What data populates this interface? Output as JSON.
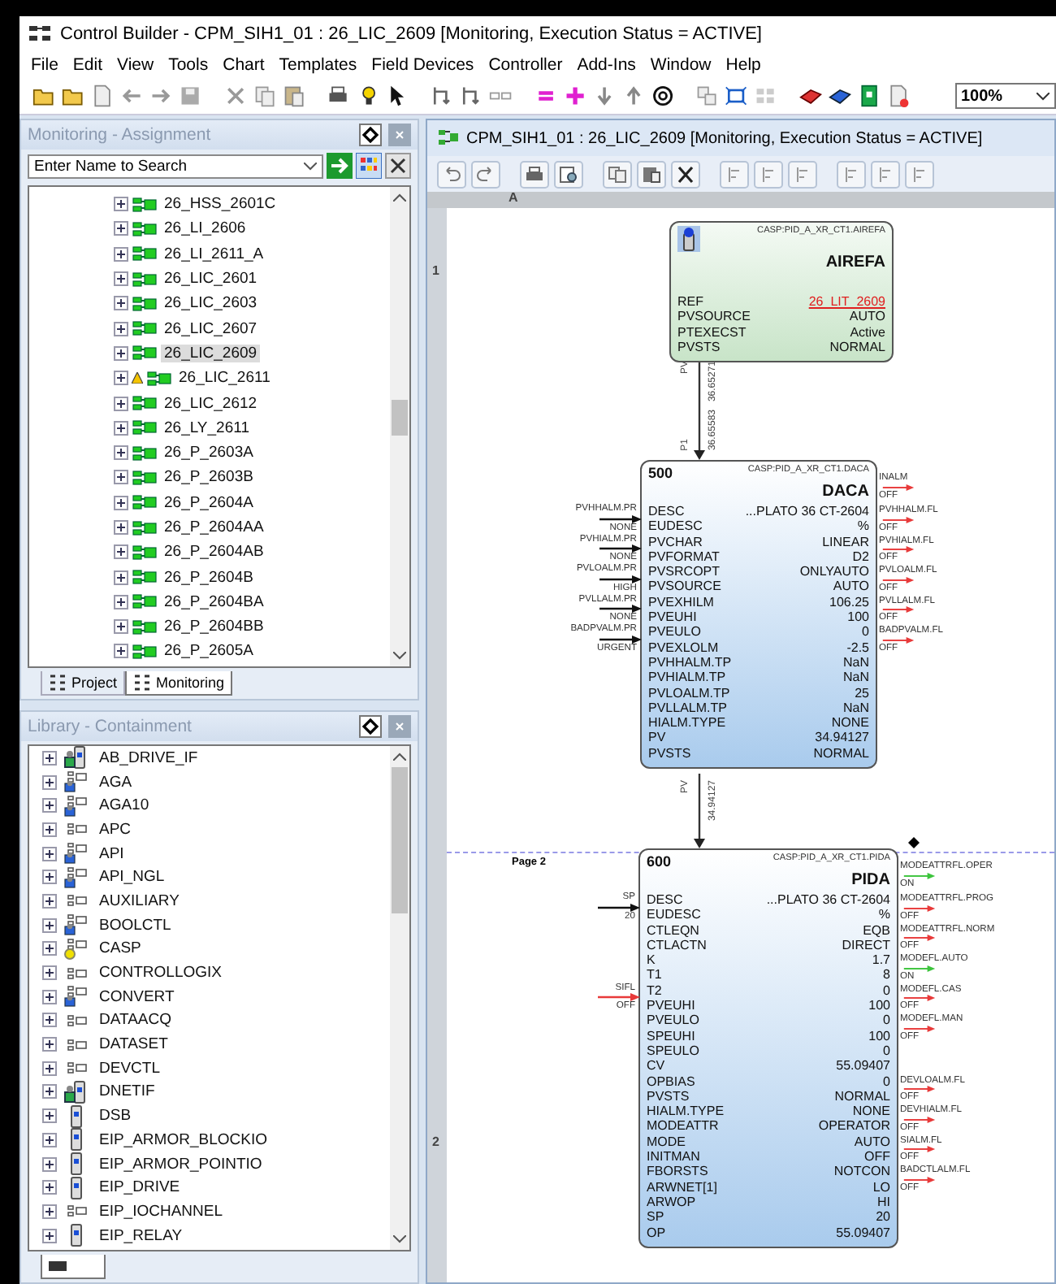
{
  "window": {
    "title": "Control Builder - CPM_SIH1_01 : 26_LIC_2609 [Monitoring, Execution Status = ACTIVE]"
  },
  "menu": [
    "File",
    "Edit",
    "View",
    "Tools",
    "Chart",
    "Templates",
    "Field Devices",
    "Controller",
    "Add-Ins",
    "Window",
    "Help"
  ],
  "zoom": {
    "value": "100%"
  },
  "assignment_panel": {
    "title": "Monitoring - Assignment",
    "search": {
      "placeholder": "Enter Name to Search"
    },
    "tree": [
      {
        "label": "26_HSS_2601C",
        "selected": false,
        "warning": false
      },
      {
        "label": "26_LI_2606",
        "selected": false,
        "warning": false
      },
      {
        "label": "26_LI_2611_A",
        "selected": false,
        "warning": false
      },
      {
        "label": "26_LIC_2601",
        "selected": false,
        "warning": false
      },
      {
        "label": "26_LIC_2603",
        "selected": false,
        "warning": false
      },
      {
        "label": "26_LIC_2607",
        "selected": false,
        "warning": false
      },
      {
        "label": "26_LIC_2609",
        "selected": true,
        "warning": false
      },
      {
        "label": "26_LIC_2611",
        "selected": false,
        "warning": true
      },
      {
        "label": "26_LIC_2612",
        "selected": false,
        "warning": false
      },
      {
        "label": "26_LY_2611",
        "selected": false,
        "warning": false
      },
      {
        "label": "26_P_2603A",
        "selected": false,
        "warning": false
      },
      {
        "label": "26_P_2603B",
        "selected": false,
        "warning": false
      },
      {
        "label": "26_P_2604A",
        "selected": false,
        "warning": false
      },
      {
        "label": "26_P_2604AA",
        "selected": false,
        "warning": false
      },
      {
        "label": "26_P_2604AB",
        "selected": false,
        "warning": false
      },
      {
        "label": "26_P_2604B",
        "selected": false,
        "warning": false
      },
      {
        "label": "26_P_2604BA",
        "selected": false,
        "warning": false
      },
      {
        "label": "26_P_2604BB",
        "selected": false,
        "warning": false
      },
      {
        "label": "26_P_2605A",
        "selected": false,
        "warning": false
      }
    ],
    "tabs": [
      {
        "label": "Project",
        "selected": false
      },
      {
        "label": "Monitoring",
        "selected": true
      }
    ]
  },
  "library_panel": {
    "title": "Library - Containment",
    "items": [
      {
        "label": "AB_DRIVE_IF",
        "kind": "module-user"
      },
      {
        "label": "AGA",
        "kind": "block-user"
      },
      {
        "label": "AGA10",
        "kind": "block-user"
      },
      {
        "label": "APC",
        "kind": "block"
      },
      {
        "label": "API",
        "kind": "block-user"
      },
      {
        "label": "API_NGL",
        "kind": "block-user"
      },
      {
        "label": "AUXILIARY",
        "kind": "block"
      },
      {
        "label": "BOOLCTL",
        "kind": "block-user"
      },
      {
        "label": "CASP",
        "kind": "block-key"
      },
      {
        "label": "CONTROLLOGIX",
        "kind": "block"
      },
      {
        "label": "CONVERT",
        "kind": "block-user"
      },
      {
        "label": "DATAACQ",
        "kind": "block"
      },
      {
        "label": "DATASET",
        "kind": "block"
      },
      {
        "label": "DEVCTL",
        "kind": "block"
      },
      {
        "label": "DNETIF",
        "kind": "module-user"
      },
      {
        "label": "DSB",
        "kind": "module"
      },
      {
        "label": "EIP_ARMOR_BLOCKIO",
        "kind": "module"
      },
      {
        "label": "EIP_ARMOR_POINTIO",
        "kind": "module"
      },
      {
        "label": "EIP_DRIVE",
        "kind": "module"
      },
      {
        "label": "EIP_IOCHANNEL",
        "kind": "block"
      },
      {
        "label": "EIP_RELAY",
        "kind": "module"
      }
    ]
  },
  "chart_window": {
    "title": "CPM_SIH1_01 : 26_LIC_2609 [Monitoring, Execution Status = ACTIVE]",
    "column_label": "A",
    "row_labels": [
      "1",
      "2"
    ],
    "page_label": "Page 2",
    "blocks": [
      {
        "kind": "reference",
        "type": "CASP:PID_A_XR_CT1.AIREFA",
        "name": "AIREFA",
        "params": [
          {
            "name": "REF",
            "value": "26_LIT_2609",
            "link": true
          },
          {
            "name": "PVSOURCE",
            "value": "AUTO",
            "link": false
          },
          {
            "name": "PTEXECST",
            "value": "Active",
            "link": false
          },
          {
            "name": "PVSTS",
            "value": "NORMAL",
            "link": false
          }
        ]
      },
      {
        "kind": "block",
        "number": "500",
        "type": "CASP:PID_A_XR_CT1.DACA",
        "name": "DACA",
        "header_output": {
          "label": "INALM",
          "value": "OFF",
          "on": false
        },
        "params": [
          {
            "name": "DESC",
            "value": "...PLATO 36 CT-2604",
            "link": false,
            "input": {
              "label": "PVHHALM.PR",
              "value": "NONE",
              "kind": "value"
            },
            "output": {
              "label": "PVHHALM.FL",
              "value": "OFF",
              "on": false
            }
          },
          {
            "name": "EUDESC",
            "value": "%",
            "link": false
          },
          {
            "name": "PVCHAR",
            "value": "LINEAR",
            "link": false,
            "input": {
              "label": "PVHIALM.PR",
              "value": "NONE",
              "kind": "value"
            },
            "output": {
              "label": "PVHIALM.FL",
              "value": "OFF",
              "on": false
            }
          },
          {
            "name": "PVFORMAT",
            "value": "D2",
            "link": false
          },
          {
            "name": "PVSRCOPT",
            "value": "ONLYAUTO",
            "link": false,
            "input": {
              "label": "PVLOALM.PR",
              "value": "HIGH",
              "kind": "value"
            },
            "output": {
              "label": "PVLOALM.FL",
              "value": "OFF",
              "on": false
            }
          },
          {
            "name": "PVSOURCE",
            "value": "AUTO",
            "link": false
          },
          {
            "name": "PVEXHILM",
            "value": "106.25",
            "link": false,
            "input": {
              "label": "PVLLALM.PR",
              "value": "NONE",
              "kind": "value"
            },
            "output": {
              "label": "PVLLALM.FL",
              "value": "OFF",
              "on": false
            }
          },
          {
            "name": "PVEUHI",
            "value": "100",
            "link": false
          },
          {
            "name": "PVEULO",
            "value": "0",
            "link": false,
            "input": {
              "label": "BADPVALM.PR",
              "value": "URGENT",
              "kind": "value"
            },
            "output": {
              "label": "BADPVALM.FL",
              "value": "OFF",
              "on": false
            }
          },
          {
            "name": "PVEXLOLM",
            "value": "-2.5",
            "link": false
          },
          {
            "name": "PVHHALM.TP",
            "value": "NaN",
            "link": false
          },
          {
            "name": "PVHIALM.TP",
            "value": "NaN",
            "link": false
          },
          {
            "name": "PVLOALM.TP",
            "value": "25",
            "link": false
          },
          {
            "name": "PVLLALM.TP",
            "value": "NaN",
            "link": false
          },
          {
            "name": "HIALM.TYPE",
            "value": "NONE",
            "link": false
          },
          {
            "name": "PV",
            "value": "34.94127",
            "link": false
          },
          {
            "name": "PVSTS",
            "value": "NORMAL",
            "link": false
          }
        ]
      },
      {
        "kind": "block",
        "number": "600",
        "type": "CASP:PID_A_XR_CT1.PIDA",
        "name": "PIDA",
        "header_output": {
          "label": "MODEATTRFL.OPER",
          "value": "ON",
          "on": true
        },
        "params": [
          {
            "name": "DESC",
            "value": "...PLATO 36 CT-2604",
            "link": false,
            "input": {
              "label": "SP",
              "value": "20",
              "kind": "value"
            },
            "output": {
              "label": "MODEATTRFL.PROG",
              "value": "OFF",
              "on": false
            }
          },
          {
            "name": "EUDESC",
            "value": "%",
            "link": false
          },
          {
            "name": "CTLEQN",
            "value": "EQB",
            "link": false,
            "output": {
              "label": "MODEATTRFL.NORM",
              "value": "OFF",
              "on": false
            }
          },
          {
            "name": "CTLACTN",
            "value": "DIRECT",
            "link": false
          },
          {
            "name": "K",
            "value": "1.7",
            "link": false,
            "output": {
              "label": "MODEFL.AUTO",
              "value": "ON",
              "on": true
            }
          },
          {
            "name": "T1",
            "value": "8",
            "link": false
          },
          {
            "name": "T2",
            "value": "0",
            "link": false,
            "input": {
              "label": "SIFL",
              "value": "OFF",
              "kind": "flag"
            },
            "output": {
              "label": "MODEFL.CAS",
              "value": "OFF",
              "on": false
            }
          },
          {
            "name": "PVEUHI",
            "value": "100",
            "link": false
          },
          {
            "name": "PVEULO",
            "value": "0",
            "link": false,
            "output": {
              "label": "MODEFL.MAN",
              "value": "OFF",
              "on": false
            }
          },
          {
            "name": "SPEUHI",
            "value": "100",
            "link": false
          },
          {
            "name": "SPEULO",
            "value": "0",
            "link": false
          },
          {
            "name": "CV",
            "value": "55.09407",
            "link": false
          },
          {
            "name": "OPBIAS",
            "value": "0",
            "link": false,
            "output": {
              "label": "DEVLOALM.FL",
              "value": "OFF",
              "on": false
            }
          },
          {
            "name": "PVSTS",
            "value": "NORMAL",
            "link": false
          },
          {
            "name": "HIALM.TYPE",
            "value": "NONE",
            "link": false,
            "output": {
              "label": "DEVHIALM.FL",
              "value": "OFF",
              "on": false
            }
          },
          {
            "name": "MODEATTR",
            "value": "OPERATOR",
            "link": false
          },
          {
            "name": "MODE",
            "value": "AUTO",
            "link": false,
            "output": {
              "label": "SIALM.FL",
              "value": "OFF",
              "on": false
            }
          },
          {
            "name": "INITMAN",
            "value": "OFF",
            "link": false
          },
          {
            "name": "FBORSTS",
            "value": "NOTCON",
            "link": false,
            "output": {
              "label": "BADCTLALM.FL",
              "value": "OFF",
              "on": false
            }
          },
          {
            "name": "ARWNET[1]",
            "value": "LO",
            "link": false
          },
          {
            "name": "ARWOP",
            "value": "HI",
            "link": false
          },
          {
            "name": "SP",
            "value": "20",
            "link": false
          },
          {
            "name": "OP",
            "value": "55.09407",
            "link": false
          }
        ]
      }
    ],
    "connectors": [
      {
        "source_pin": "PV",
        "source_value": "36.65271",
        "target_pin": "P1",
        "target_value": "36.65583"
      },
      {
        "source_pin": "PV",
        "source_value": "34.94127"
      }
    ]
  }
}
